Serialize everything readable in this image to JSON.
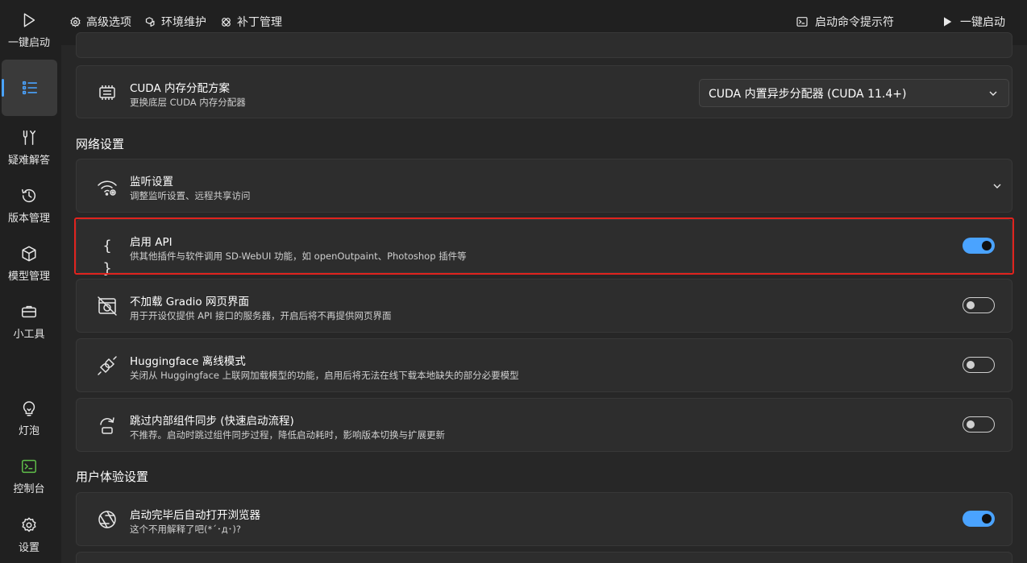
{
  "sidebar": {
    "items": [
      {
        "label": "一键启动",
        "icon": "play-icon"
      },
      {
        "label": "",
        "icon": "list-icon",
        "active": true
      },
      {
        "label": "疑难解答",
        "icon": "wrench-icon"
      },
      {
        "label": "版本管理",
        "icon": "history-icon"
      },
      {
        "label": "模型管理",
        "icon": "cube-icon"
      },
      {
        "label": "小工具",
        "icon": "toolbox-icon"
      },
      {
        "label": "灯泡",
        "icon": "lightbulb-icon"
      },
      {
        "label": "控制台",
        "icon": "console-icon"
      },
      {
        "label": "设置",
        "icon": "gear-icon"
      }
    ]
  },
  "topbar": {
    "tabs": [
      {
        "label": "高级选项",
        "icon": "settings-icon",
        "active": true
      },
      {
        "label": "环境维护",
        "icon": "cubes-icon"
      },
      {
        "label": "补丁管理",
        "icon": "patch-icon"
      }
    ],
    "console_label": "启动命令提示符",
    "launch_label": "一键启动"
  },
  "cuda": {
    "title": "CUDA 内存分配方案",
    "desc": "更换底层 CUDA 内存分配器",
    "selected": "CUDA 内置异步分配器 (CUDA 11.4+)"
  },
  "network": {
    "section_title": "网络设置",
    "listen": {
      "title": "监听设置",
      "desc": "调整监听设置、远程共享访问"
    },
    "api": {
      "title": "启用 API",
      "desc": "供其他插件与软件调用 SD-WebUI 功能，如 openOutpaint、Photoshop 插件等",
      "on": true
    },
    "gradio": {
      "title": "不加载 Gradio 网页界面",
      "desc": "用于开设仅提供 API 接口的服务器，开启后将不再提供网页界面",
      "on": false
    },
    "hf": {
      "title": "Huggingface 离线模式",
      "desc": "关闭从 Huggingface 上联网加载模型的功能，启用后将无法在线下载本地缺失的部分必要模型",
      "on": false
    },
    "skip": {
      "title": "跳过内部组件同步 (快速启动流程)",
      "desc": "不推荐。启动时跳过组件同步过程，降低启动耗时，影响版本切换与扩展更新",
      "on": false
    }
  },
  "ux": {
    "section_title": "用户体验设置",
    "browser": {
      "title": "启动完毕后自动打开浏览器",
      "desc": "这个不用解释了吧(*´･д･)?",
      "on": true
    }
  },
  "colors": {
    "accent": "#4aa3ff",
    "highlight": "#e0231e",
    "console_icon": "#5fbf4a"
  }
}
